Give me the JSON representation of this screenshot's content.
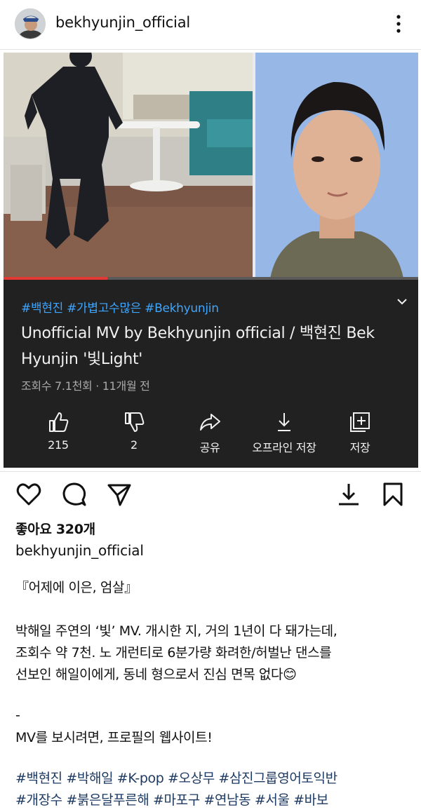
{
  "post": {
    "username": "bekhyunjin_official",
    "likes_label": "좋아요 320개",
    "caption_username": "bekhyunjin_official",
    "caption_lines": [
      "『어제에 이은, 엄살』",
      "박해일 주연의 ‘빛’ MV. 개시한 지, 거의 1년이 다 돼가는데,",
      "조회수 약 7천. 노 개런티로 6분가량 화려한/허벌난 댄스를",
      "선보인 해일이에게, 동네 형으로서 진심 면목 없다😊",
      "-",
      "MV를 보시려면, 프로필의 웹사이트!"
    ],
    "hashtag_lines": [
      "#백현진 #박해일 #K-pop #오상무 #삼진그룹영어토익반",
      "#개장수 #붉은달푸른해 #마포구 #연남동 #서울 #바보"
    ],
    "icons": [
      "heart-icon",
      "comment-icon",
      "share-icon",
      "download-icon",
      "bookmark-icon",
      "more-vertical-icon"
    ]
  },
  "video": {
    "hashtags": "#백현진 #가볍고수많은 #Bekhyunjin",
    "title": "Unofficial MV by Bekhyunjin official / 백현진 Bek Hyunjin '빛Light'",
    "meta": "조회수 7.1천회 · 11개월 전",
    "progress_fraction": 0.25,
    "actions": [
      {
        "icon": "thumbs-up-icon",
        "label": "215"
      },
      {
        "icon": "thumbs-down-icon",
        "label": "2"
      },
      {
        "icon": "share-arrow-icon",
        "label": "공유"
      },
      {
        "icon": "download-icon",
        "label": "오프라인 저장"
      },
      {
        "icon": "add-to-playlist-icon",
        "label": "저장"
      }
    ],
    "colors": {
      "background": "#212121",
      "link": "#3ea6ff",
      "progress": "#e53935"
    }
  }
}
